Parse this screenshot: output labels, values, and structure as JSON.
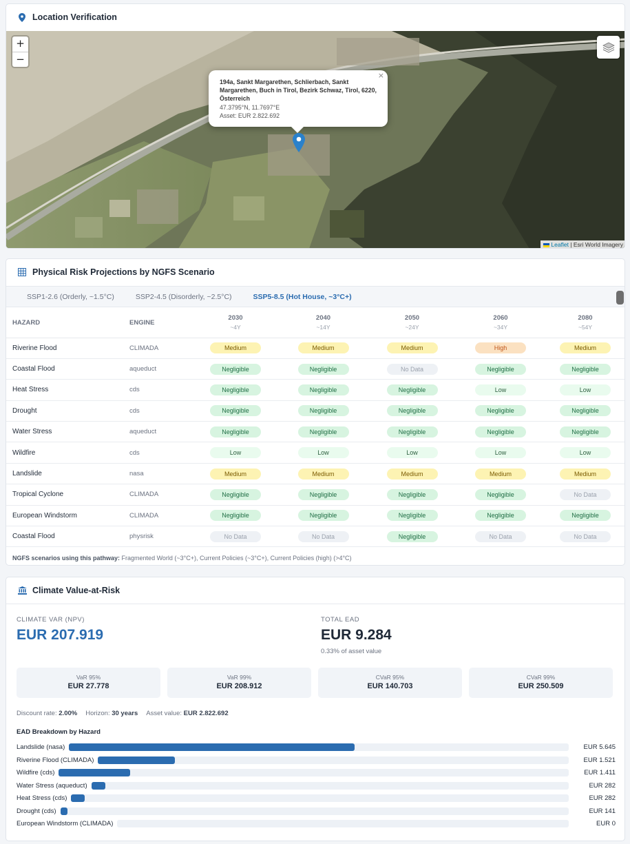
{
  "map_card": {
    "title": "Location Verification",
    "zoom_in": "+",
    "zoom_out": "−",
    "popup": {
      "address": "194a, Sankt Margarethen, Schlierbach, Sankt Margarethen, Buch in Tirol, Bezirk Schwaz, Tirol, 6220, Österreich",
      "coords": "47.3795°N, 11.7697°E",
      "asset": "Asset: EUR 2.822.692",
      "close": "×"
    },
    "attribution": {
      "link": "Leaflet",
      "rest": " | Esri World Imagery"
    }
  },
  "risk_card": {
    "title": "Physical Risk Projections by NGFS Scenario",
    "tabs": [
      {
        "label": "SSP1-2.6 (Orderly, ~1.5°C)",
        "active": false
      },
      {
        "label": "SSP2-4.5 (Disorderly, ~2.5°C)",
        "active": false
      },
      {
        "label": "SSP5-8.5 (Hot House, ~3°C+)",
        "active": true
      }
    ],
    "headers": {
      "hazard": "HAZARD",
      "engine": "ENGINE"
    },
    "years": [
      {
        "year": "2030",
        "sub": "~4Y"
      },
      {
        "year": "2040",
        "sub": "~14Y"
      },
      {
        "year": "2050",
        "sub": "~24Y"
      },
      {
        "year": "2060",
        "sub": "~34Y"
      },
      {
        "year": "2080",
        "sub": "~54Y"
      }
    ],
    "rows": [
      {
        "hazard": "Riverine Flood",
        "engine": "CLIMADA",
        "levels": [
          "Medium",
          "Medium",
          "Medium",
          "High",
          "Medium"
        ]
      },
      {
        "hazard": "Coastal Flood",
        "engine": "aqueduct",
        "levels": [
          "Negligible",
          "Negligible",
          "No Data",
          "Negligible",
          "Negligible"
        ]
      },
      {
        "hazard": "Heat Stress",
        "engine": "cds",
        "levels": [
          "Negligible",
          "Negligible",
          "Negligible",
          "Low",
          "Low"
        ]
      },
      {
        "hazard": "Drought",
        "engine": "cds",
        "levels": [
          "Negligible",
          "Negligible",
          "Negligible",
          "Negligible",
          "Negligible"
        ]
      },
      {
        "hazard": "Water Stress",
        "engine": "aqueduct",
        "levels": [
          "Negligible",
          "Negligible",
          "Negligible",
          "Negligible",
          "Negligible"
        ]
      },
      {
        "hazard": "Wildfire",
        "engine": "cds",
        "levels": [
          "Low",
          "Low",
          "Low",
          "Low",
          "Low"
        ]
      },
      {
        "hazard": "Landslide",
        "engine": "nasa",
        "levels": [
          "Medium",
          "Medium",
          "Medium",
          "Medium",
          "Medium"
        ]
      },
      {
        "hazard": "Tropical Cyclone",
        "engine": "CLIMADA",
        "levels": [
          "Negligible",
          "Negligible",
          "Negligible",
          "Negligible",
          "No Data"
        ]
      },
      {
        "hazard": "European Windstorm",
        "engine": "CLIMADA",
        "levels": [
          "Negligible",
          "Negligible",
          "Negligible",
          "Negligible",
          "Negligible"
        ]
      },
      {
        "hazard": "Coastal Flood",
        "engine": "physrisk",
        "levels": [
          "No Data",
          "No Data",
          "Negligible",
          "No Data",
          "No Data"
        ]
      }
    ],
    "note_label": "NGFS scenarios using this pathway:",
    "note_text": " Fragmented World (~3°C+), Current Policies (~3°C+), Current Policies (high) (>4°C)",
    "colors": {
      "medium": "#fdf3b3",
      "high": "#fbe1c1",
      "negligible": "#d7f4e0",
      "low": "#e9fbee",
      "no_data": "#eef1f5",
      "accent": "#2b6cb0"
    }
  },
  "var_card": {
    "title": "Climate Value-at-Risk",
    "climate_var_label": "CLIMATE VAR (NPV)",
    "climate_var_value": "EUR 207.919",
    "total_ead_label": "TOTAL EAD",
    "total_ead_value": "EUR 9.284",
    "total_ead_sub": "0.33% of asset value",
    "metrics": [
      {
        "label": "VaR 95%",
        "value": "EUR 27.778"
      },
      {
        "label": "VaR 99%",
        "value": "EUR 208.912"
      },
      {
        "label": "CVaR 95%",
        "value": "EUR 140.703"
      },
      {
        "label": "CVaR 99%",
        "value": "EUR 250.509"
      }
    ],
    "params": {
      "discount_label": "Discount rate:",
      "discount_value": "2.00%",
      "horizon_label": "Horizon:",
      "horizon_value": "30 years",
      "asset_label": "Asset value:",
      "asset_value": "EUR 2.822.692"
    },
    "ead_title": "EAD Breakdown by Hazard",
    "ead": [
      {
        "label": "Landslide (nasa)",
        "value": "EUR 5.645",
        "share": 0.608
      },
      {
        "label": "Riverine Flood (CLIMADA)",
        "value": "EUR 1.521",
        "share": 0.164
      },
      {
        "label": "Wildfire (cds)",
        "value": "EUR 1.411",
        "share": 0.152
      },
      {
        "label": "Water Stress (aqueduct)",
        "value": "EUR 282",
        "share": 0.03
      },
      {
        "label": "Heat Stress (cds)",
        "value": "EUR 282",
        "share": 0.03
      },
      {
        "label": "Drought (cds)",
        "value": "EUR 141",
        "share": 0.015
      },
      {
        "label": "European Windstorm (CLIMADA)",
        "value": "EUR 0",
        "share": 0.0
      }
    ]
  }
}
